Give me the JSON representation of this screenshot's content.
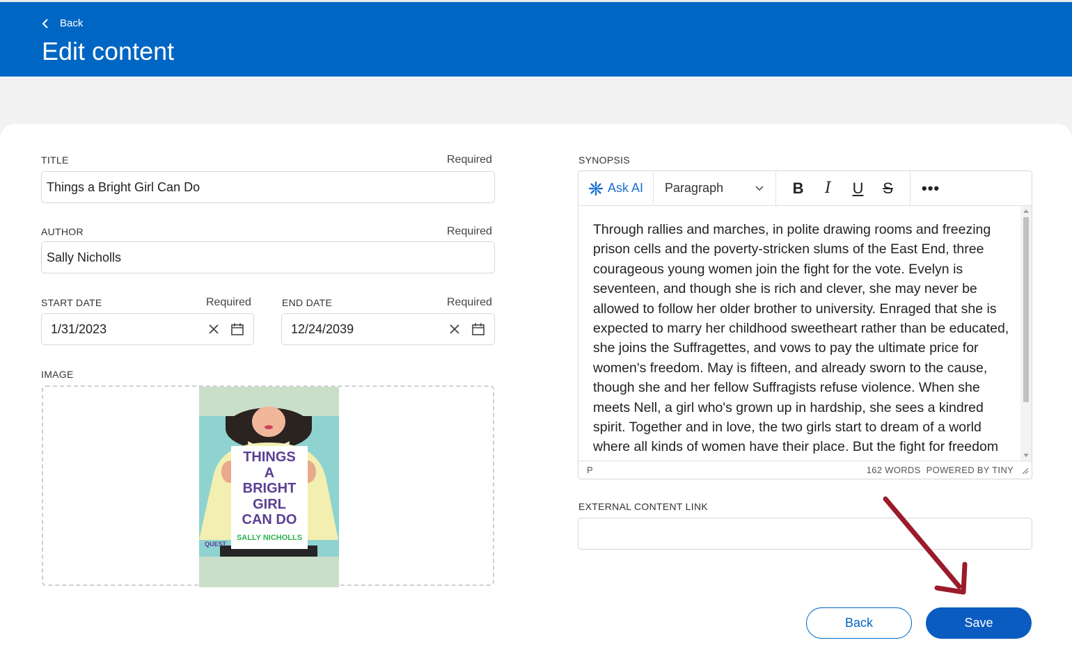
{
  "header": {
    "back_label": "Back",
    "title": "Edit content"
  },
  "form": {
    "title": {
      "label": "TITLE",
      "required": "Required",
      "value": "Things a Bright Girl Can Do"
    },
    "author": {
      "label": "AUTHOR",
      "required": "Required",
      "value": "Sally Nicholls"
    },
    "start_date": {
      "label": "START DATE",
      "required": "Required",
      "value": "1/31/2023"
    },
    "end_date": {
      "label": "END DATE",
      "required": "Required",
      "value": "12/24/2039"
    },
    "image": {
      "label": "IMAGE",
      "cover_title": [
        "THINGS",
        "A",
        "BRIGHT",
        "GIRL",
        "CAN DO"
      ],
      "cover_author": "SALLY NICHOLLS",
      "cover_badge": "QUEST"
    },
    "synopsis": {
      "label": "SYNOPSIS",
      "ask_ai": "Ask AI",
      "block_format": "Paragraph",
      "format_buttons": [
        "B",
        "I",
        "U",
        "S"
      ],
      "more": "•••",
      "text": "Through rallies and marches, in polite drawing rooms and freezing prison cells and the poverty-stricken slums of the East End, three courageous young women join the fight for the vote. Evelyn is seventeen, and though she is rich and clever, she may never be allowed to follow her older brother to university. Enraged that she is expected to marry her childhood sweetheart rather than be educated, she joins the Suffragettes, and vows to pay the ultimate price for women's freedom. May is fifteen, and already sworn to the cause, though she and her fellow Suffragists refuse violence. When she meets Nell, a girl who's grown up in hardship, she sees a kindred spirit. Together and in love, the two girls start to dream of a world where all kinds of women have their place. But the fight for freedom will challenge Evelyn, May and Nell more than they ever imagined.",
      "path": "P",
      "word_count": "162 WORDS",
      "powered_by": "POWERED BY TINY"
    },
    "external_link": {
      "label": "EXTERNAL CONTENT LINK",
      "value": ""
    }
  },
  "actions": {
    "back": "Back",
    "save": "Save"
  },
  "colors": {
    "header_bg": "#0066c3",
    "primary": "#0b5cc1",
    "annotation_arrow": "#9b1b2a"
  }
}
